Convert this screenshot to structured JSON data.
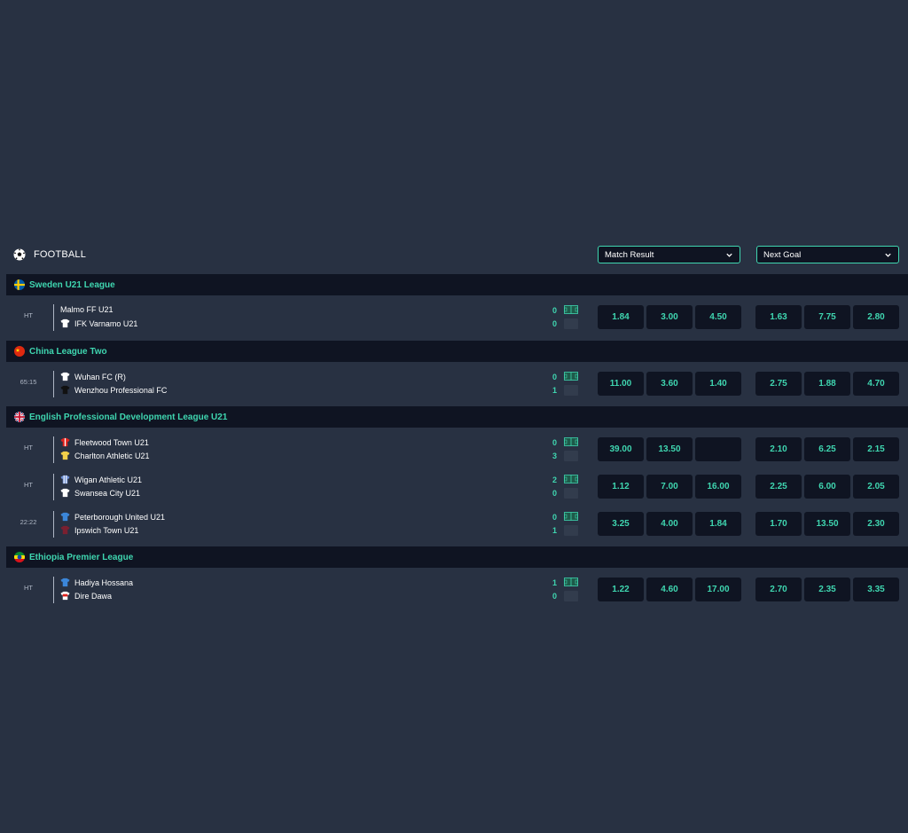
{
  "sport": {
    "title": "FOOTBALL",
    "icon": "football-icon"
  },
  "markets": {
    "first": "Match Result",
    "second": "Next Goal"
  },
  "colors": {
    "accent": "#3fd6b0",
    "background": "#283142",
    "panel": "#0f1422"
  },
  "leagues": [
    {
      "name": "Sweden U21 League",
      "flag": "sweden-flag-icon",
      "matches": [
        {
          "time": "HT",
          "home": "Malmo FF U21",
          "away": "IFK Varnamo U21",
          "home_score": "0",
          "away_score": "0",
          "match_result": [
            "1.84",
            "3.00",
            "4.50"
          ],
          "next_goal": [
            "1.63",
            "7.75",
            "2.80"
          ]
        }
      ]
    },
    {
      "name": "China League Two",
      "flag": "china-flag-icon",
      "matches": [
        {
          "time": "65:15",
          "home": "Wuhan FC (R)",
          "away": "Wenzhou Professional FC",
          "home_score": "0",
          "away_score": "1",
          "match_result": [
            "11.00",
            "3.60",
            "1.40"
          ],
          "next_goal": [
            "2.75",
            "1.88",
            "4.70"
          ]
        }
      ]
    },
    {
      "name": "English Professional Development League U21",
      "flag": "uk-flag-icon",
      "matches": [
        {
          "time": "HT",
          "home": "Fleetwood Town U21",
          "away": "Charlton Athletic U21",
          "home_score": "0",
          "away_score": "3",
          "match_result": [
            "39.00",
            "13.50",
            ""
          ],
          "next_goal": [
            "2.10",
            "6.25",
            "2.15"
          ]
        },
        {
          "time": "HT",
          "home": "Wigan Athletic U21",
          "away": "Swansea City U21",
          "home_score": "2",
          "away_score": "0",
          "match_result": [
            "1.12",
            "7.00",
            "16.00"
          ],
          "next_goal": [
            "2.25",
            "6.00",
            "2.05"
          ]
        },
        {
          "time": "22:22",
          "home": "Peterborough United U21",
          "away": "Ipswich Town U21",
          "home_score": "0",
          "away_score": "1",
          "match_result": [
            "3.25",
            "4.00",
            "1.84"
          ],
          "next_goal": [
            "1.70",
            "13.50",
            "2.30"
          ]
        }
      ]
    },
    {
      "name": "Ethiopia Premier League",
      "flag": "ethiopia-flag-icon",
      "matches": [
        {
          "time": "HT",
          "home": "Hadiya Hossana",
          "away": "Dire Dawa",
          "home_score": "1",
          "away_score": "0",
          "match_result": [
            "1.22",
            "4.60",
            "17.00"
          ],
          "next_goal": [
            "2.70",
            "2.35",
            "3.35"
          ]
        }
      ]
    }
  ]
}
